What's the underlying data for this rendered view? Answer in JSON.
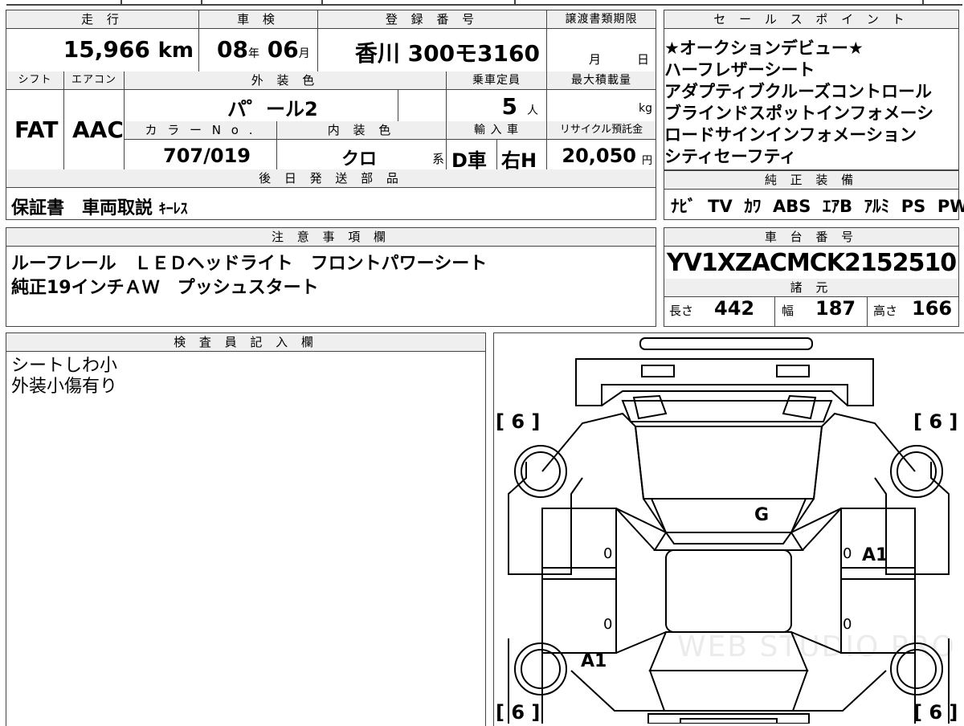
{
  "top_row": {
    "mileage_label": "走 行",
    "mileage_value": "15,966",
    "mileage_unit": "km",
    "shaken_label": "車 検",
    "shaken_year": "08",
    "shaken_year_unit": "年",
    "shaken_month": "06",
    "shaken_month_unit": "月",
    "reg_label": "登 録 番 号",
    "reg_value": "香川 300モ3160",
    "transfer_label": "譲渡書類期限",
    "transfer_month_unit": "月",
    "transfer_day_unit": "日"
  },
  "mid_row": {
    "shift_label": "シフト",
    "shift_value": "FAT",
    "ac_label": "エアコン",
    "ac_value": "AAC",
    "ext_color_label": "外 装 色",
    "ext_color_value": "パ゜ール2",
    "capacity_label": "乗車定員",
    "capacity_value": "5",
    "capacity_unit": "人",
    "maxload_label": "最大積載量",
    "maxload_unit": "kg",
    "color_no_label": "カ ラ ー N o .",
    "color_no_value": "707/019",
    "int_color_label": "内 装 色",
    "int_color_value": "クロ",
    "int_color_suffix": "系",
    "import_label": "輸 入 車",
    "import_value1": "D車",
    "import_value2": "右H",
    "recycle_label": "リサイクル預託金",
    "recycle_value": "20,050",
    "recycle_unit": "円"
  },
  "later_parts": {
    "label": "後 日 発 送 部 品",
    "value_main": "保証書　車両取説",
    "value_small": "ｷｰﾚｽ"
  },
  "sales_points": {
    "label": "セ ー ル ス ポ イ ン ト",
    "lines": [
      "★オークションデビュー★",
      "ハーフレザーシート",
      "アダプティブクルーズコントロール",
      "ブラインドスポットインフォメーシ",
      "ロードサインインフォメーション",
      "シティセーフティ"
    ]
  },
  "genuine_equipment": {
    "label": "純 正 装 備",
    "items": [
      "ﾅﾋﾞ",
      "TV",
      "ｶﾜ",
      "ABS",
      "ｴｱB",
      "ｱﾙﾐ",
      "PS",
      "PW"
    ]
  },
  "notes": {
    "label": "注 意 事 項 欄",
    "lines": [
      "ルーフレール　ＬＥＤヘッドライト　フロントパワーシート",
      "純正19インチＡＷ　プッシュスタート"
    ]
  },
  "chassis": {
    "label": "車 台 番 号",
    "value": "YV1XZACMCK2152510"
  },
  "specs": {
    "label": "諸 元",
    "length_label": "長さ",
    "length_value": "442",
    "width_label": "幅",
    "width_value": "187",
    "height_label": "高さ",
    "height_value": "166"
  },
  "inspector": {
    "label": "検 査 員 記 入 欄",
    "lines": [
      "シートしわ小",
      "外装小傷有り"
    ]
  },
  "car_diagram": {
    "tire_left_front": "[ 6 ]",
    "tire_right_front": "[ 6 ]",
    "tire_left_rear": "[ 6 ]",
    "tire_right_rear": "[ 6 ]",
    "mark_windshield": "G",
    "mark_right_front_door": "A1",
    "mark_left_rear": "A1",
    "zero_marks": [
      "0",
      "0",
      "0",
      "0"
    ],
    "watermark": "WEB STUDIO PRO"
  }
}
